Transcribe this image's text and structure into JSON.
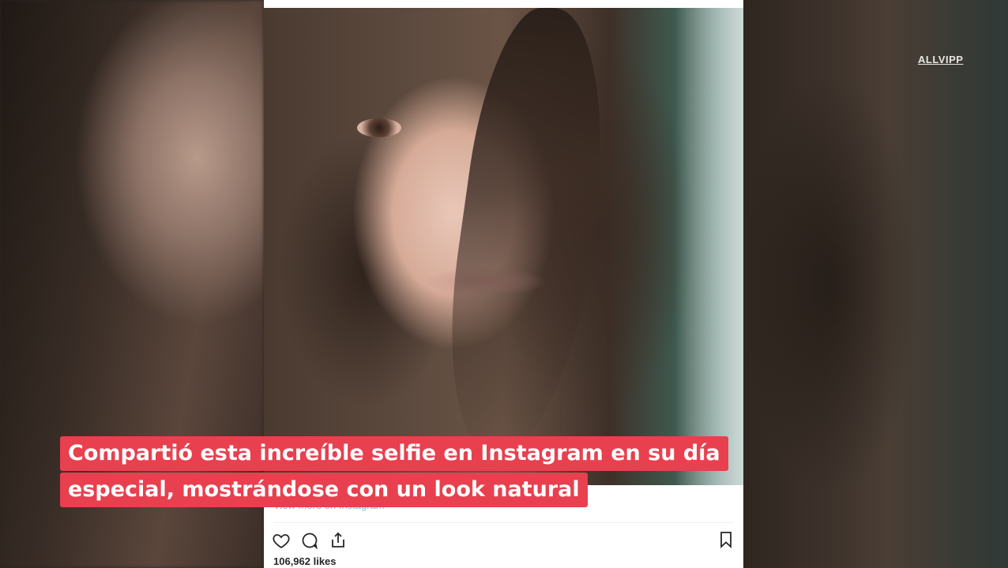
{
  "watermark": {
    "text": "ALLVIPP"
  },
  "post": {
    "view_more_text": "View more on Instagram",
    "likes_text": "106,962 likes",
    "icons": [
      "heart-icon",
      "comment-icon",
      "share-icon",
      "bookmark-icon"
    ]
  },
  "caption": {
    "line1": "Compartió esta increíble selfie en Instagram en su día",
    "line2": "especial, mostrándose con un look natural",
    "background_color": "#e8404f"
  }
}
